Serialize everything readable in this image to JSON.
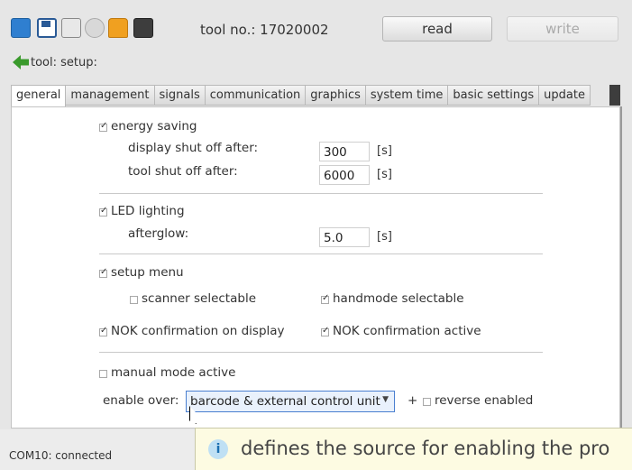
{
  "toolbar": {
    "icons": [
      "folder-open-icon",
      "save-icon",
      "list-icon",
      "gear-icon",
      "person-icon",
      "calculator-icon"
    ],
    "tool_no": "tool no.: 17020002",
    "read_label": "read",
    "write_label": "write"
  },
  "breadcrumb": {
    "text": "tool: setup:"
  },
  "tabs": [
    "general",
    "management",
    "signals",
    "communication",
    "graphics",
    "system time",
    "basic settings",
    "update"
  ],
  "general": {
    "energy_saving": {
      "label": "energy saving",
      "checked": true
    },
    "display_shutoff": {
      "label": "display shut off after:",
      "value": "300",
      "unit": "[s]"
    },
    "tool_shutoff": {
      "label": "tool shut off after:",
      "value": "6000",
      "unit": "[s]"
    },
    "led_lighting": {
      "label": "LED lighting",
      "checked": true
    },
    "afterglow": {
      "label": "afterglow:",
      "value": "5.0",
      "unit": "[s]"
    },
    "setup_menu": {
      "label": "setup menu",
      "checked": true
    },
    "scanner_selectable": {
      "label": "scanner selectable",
      "checked": false
    },
    "handmode_selectable": {
      "label": "handmode selectable",
      "checked": true
    },
    "nok_display": {
      "label": "NOK confirmation on display",
      "checked": true
    },
    "nok_active": {
      "label": "NOK confirmation active",
      "checked": true
    },
    "manual_mode": {
      "label": "manual mode active",
      "checked": false
    },
    "enable_over": {
      "label": "enable over:",
      "value": "barcode & external control unit",
      "plus": "+",
      "reverse_label": "reverse enabled",
      "reverse_checked": false
    }
  },
  "status": {
    "text": "COM10: connected"
  },
  "tooltip": {
    "text": "defines the source for enabling the pro"
  }
}
